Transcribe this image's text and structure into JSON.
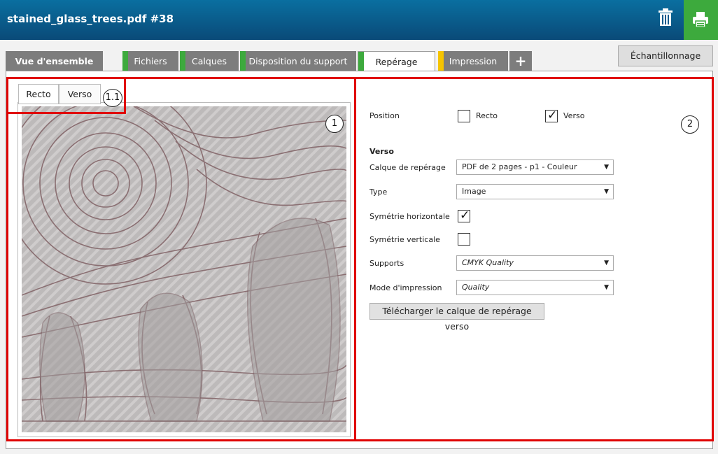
{
  "window": {
    "title": "stained_glass_trees.pdf #38"
  },
  "tabs": [
    {
      "label": "Vue d'ensemble",
      "marker": ""
    },
    {
      "label": "Fichiers",
      "marker": "#3daa3d"
    },
    {
      "label": "Calques",
      "marker": "#3daa3d"
    },
    {
      "label": "Disposition du support",
      "marker": "#3daa3d"
    },
    {
      "label": "Repérage",
      "marker": "#3daa3d"
    },
    {
      "label": "Impression",
      "marker": "#f5c400"
    }
  ],
  "add_tab_label": "+",
  "sampling_label": "Échantillonnage",
  "left": {
    "subtabs": [
      "Recto",
      "Verso"
    ],
    "active_subtab": "Recto"
  },
  "callouts": {
    "left": "1",
    "subtabs": "1.1",
    "right": "2"
  },
  "form": {
    "position_label": "Position",
    "position_recto": {
      "label": "Recto",
      "checked": false
    },
    "position_verso": {
      "label": "Verso",
      "checked": true
    },
    "section_title": "Verso",
    "calque_label": "Calque de repérage",
    "calque_value": "PDF de 2 pages - p1 - Couleur",
    "type_label": "Type",
    "type_value": "Image",
    "sym_h_label": "Symétrie horizontale",
    "sym_h_checked": true,
    "sym_v_label": "Symétrie verticale",
    "sym_v_checked": false,
    "supports_label": "Supports",
    "supports_value": "CMYK Quality",
    "mode_label": "Mode d'impression",
    "mode_value": "Quality",
    "download_label": "Télécharger le calque de repérage verso"
  },
  "colors": {
    "titlebar": "#0a5a8c",
    "print_button": "#3daa3d",
    "highlight": "#e00000",
    "tab_bg": "#7d7d7d"
  },
  "icons": {
    "trash": "trash-icon",
    "print": "printer-icon",
    "dropdown": "chevron-down-icon"
  }
}
